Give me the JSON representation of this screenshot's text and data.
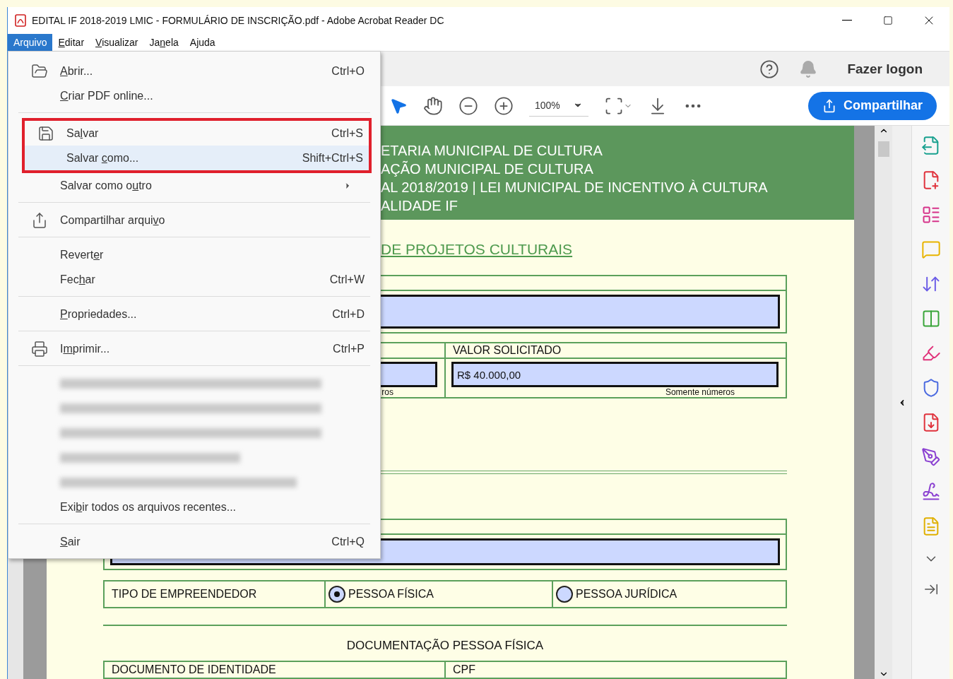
{
  "window": {
    "title": "EDITAL IF 2018-2019 LMIC - FORMULÁRIO DE INSCRIÇÃO.pdf - Adobe Acrobat Reader DC"
  },
  "menubar": [
    {
      "label": {
        "before": "Arquivo"
      },
      "selected": true
    },
    {
      "label": {
        "key": "E",
        "after": "ditar"
      },
      "selected": false
    },
    {
      "label": {
        "key": "V",
        "after": "isualizar"
      },
      "selected": false
    },
    {
      "label": {
        "before": "Ja",
        "key": "n",
        "after": "ela"
      },
      "selected": false
    },
    {
      "label": {
        "before": "A",
        "key": "j",
        "after": "uda"
      },
      "selected": false
    }
  ],
  "file_menu": {
    "sections": [
      {
        "items": [
          {
            "kind": "command",
            "label": {
              "key": "A",
              "after": "brir..."
            },
            "shortcut": "Ctrl+O",
            "selected": false,
            "outlined": false
          },
          {
            "kind": "command",
            "label": {
              "key": "C",
              "after": "riar PDF online..."
            },
            "selected": false,
            "outlined": false
          }
        ]
      },
      {
        "items": [
          {
            "kind": "command",
            "label": {
              "before": "Sa",
              "key": "l",
              "after": "var"
            },
            "shortcut": "Ctrl+S",
            "selected": false,
            "outlined": true
          },
          {
            "kind": "command",
            "label": {
              "before": "Salvar ",
              "key": "c",
              "after": "omo..."
            },
            "shortcut": "Shift+Ctrl+S",
            "selected": true,
            "outlined": true
          },
          {
            "kind": "submenu",
            "label": {
              "before": "Salvar como o",
              "key": "u",
              "after": "tro"
            },
            "selected": false,
            "outlined": false
          }
        ]
      },
      {
        "items": [
          {
            "kind": "command",
            "label": {
              "before": "Compartilhar arqui",
              "key": "v",
              "after": "o"
            },
            "selected": false,
            "outlined": false
          }
        ]
      },
      {
        "items": [
          {
            "kind": "command",
            "label": {
              "before": "Revert",
              "key": "e",
              "after": "r"
            },
            "selected": false,
            "outlined": false
          },
          {
            "kind": "command",
            "label": {
              "before": "Fec",
              "key": "h",
              "after": "ar"
            },
            "shortcut": "Ctrl+W",
            "selected": false,
            "outlined": false
          }
        ]
      },
      {
        "items": [
          {
            "kind": "command",
            "label": {
              "key": "P",
              "after": "ropriedades..."
            },
            "shortcut": "Ctrl+D",
            "selected": false,
            "outlined": false
          }
        ]
      },
      {
        "items": [
          {
            "kind": "command",
            "label": {
              "before": "I",
              "key": "m",
              "after": "primir..."
            },
            "shortcut": "Ctrl+P",
            "selected": false,
            "outlined": false
          }
        ]
      },
      {
        "items": [
          {
            "kind": "blurred"
          },
          {
            "kind": "blurred"
          },
          {
            "kind": "blurred"
          },
          {
            "kind": "blurred"
          },
          {
            "kind": "blurred"
          },
          {
            "kind": "command",
            "label": {
              "before": "Exi",
              "key": "b",
              "after": "ir todos os arquivos recentes..."
            },
            "selected": false,
            "outlined": false
          }
        ]
      },
      {
        "items": [
          {
            "kind": "command",
            "label": {
              "key": "S",
              "after": "air"
            },
            "shortcut": "Ctrl+Q",
            "selected": false,
            "outlined": false
          }
        ]
      }
    ]
  },
  "top_bar": {
    "sign_in": "Fazer logon"
  },
  "toolbar": {
    "zoom": "100%",
    "share_button": "Compartilhar"
  },
  "document": {
    "header_lines": [
      "ETARIA MUNICIPAL DE CULTURA",
      "AÇÃO MUNICIPAL DE CULTURA",
      "AL 2018/2019 | LEI MUNICIPAL DE INCENTIVO À CULTURA",
      "ALIDADE IF"
    ],
    "section_title": "DE PROJETOS CULTURAIS",
    "value_row": {
      "left_hint": "ros",
      "heading": "VALOR SOLICITADO",
      "value": "R$ 40.000,00",
      "hint": "Somente números"
    },
    "entrepreneur": {
      "label": "TIPO DE EMPREENDEDOR",
      "options": [
        {
          "label": "PESSOA FÍSICA",
          "selected": true
        },
        {
          "label": "PESSOA JURÍDICA",
          "selected": false
        }
      ]
    },
    "docs_title": "DOCUMENTAÇÃO PESSOA FÍSICA",
    "docs_columns": [
      "DOCUMENTO DE IDENTIDADE",
      "CPF"
    ]
  }
}
